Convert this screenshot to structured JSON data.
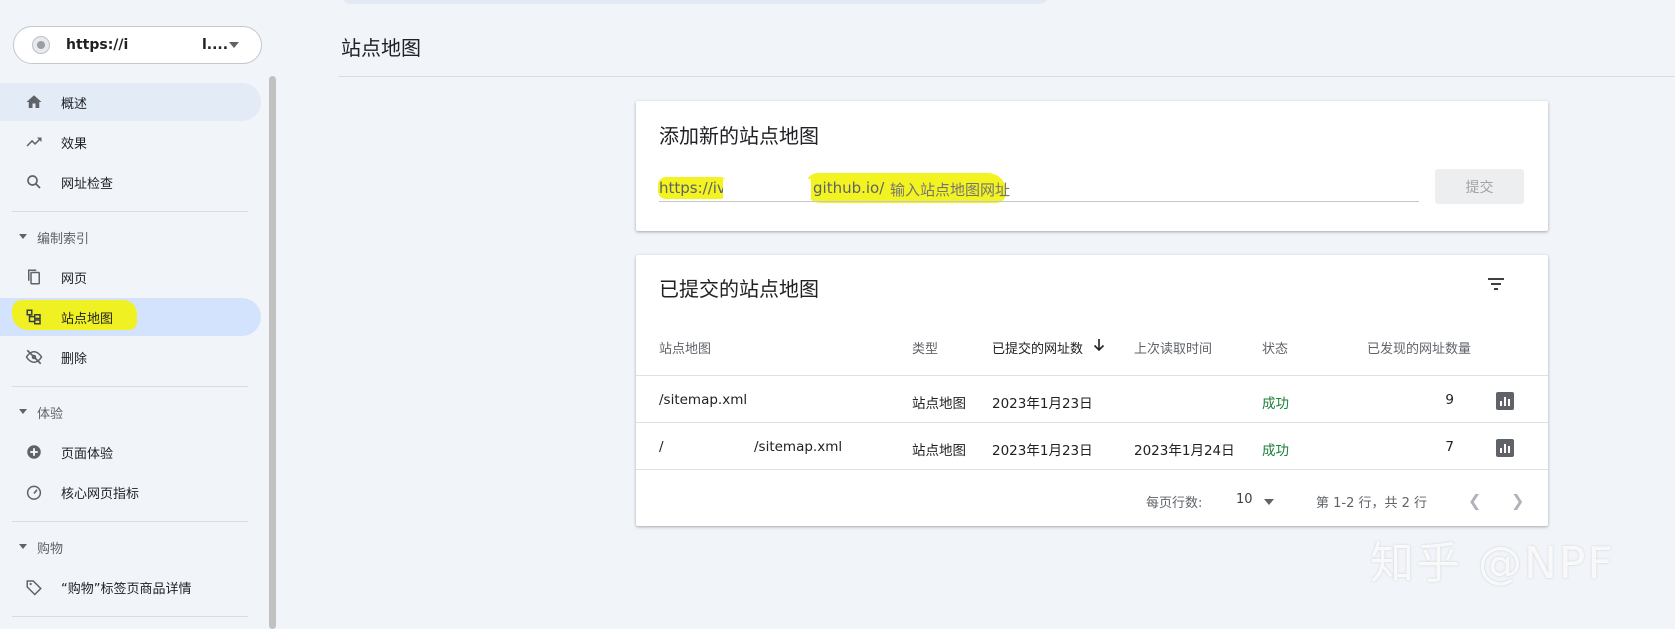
{
  "property": {
    "url_prefix": "https://i",
    "url_suffix": "l...."
  },
  "sidebar": {
    "top_items": [
      {
        "label": "概述",
        "icon": "home-icon"
      },
      {
        "label": "效果",
        "icon": "trending-up-icon"
      },
      {
        "label": "网址检查",
        "icon": "search-icon"
      }
    ],
    "sections": [
      {
        "title": "编制索引",
        "items": [
          {
            "label": "网页",
            "icon": "pages-icon"
          },
          {
            "label": "站点地图",
            "icon": "sitemap-icon"
          },
          {
            "label": "删除",
            "icon": "visibility-off-icon"
          }
        ]
      },
      {
        "title": "体验",
        "items": [
          {
            "label": "页面体验",
            "icon": "add-circle-icon"
          },
          {
            "label": "核心网页指标",
            "icon": "speedometer-icon"
          }
        ]
      },
      {
        "title": "购物",
        "items": [
          {
            "label": "“购物”标签页商品详情",
            "icon": "tag-icon"
          }
        ]
      }
    ]
  },
  "page_title": "站点地图",
  "add_card": {
    "title": "添加新的站点地图",
    "prefix_a": "https://ivan",
    "prefix_b": "github.io/",
    "placeholder": "输入站点地图网址",
    "submit_label": "提交"
  },
  "submitted_card": {
    "title": "已提交的站点地图",
    "columns": [
      "站点地图",
      "类型",
      "已提交的网址数",
      "上次读取时间",
      "状态",
      "已发现的网址数量"
    ],
    "sort_icon": "arrow-down-icon",
    "rows": [
      {
        "sitemap": "/sitemap.xml",
        "type": "站点地图",
        "submitted": "2023年1月23日",
        "last_read": "",
        "status": "成功",
        "discovered": "9"
      },
      {
        "sitemap": "/sitemap.xml",
        "type": "站点地图",
        "submitted": "2023年1月23日",
        "last_read": "2023年1月24日",
        "status": "成功",
        "discovered": "7"
      }
    ],
    "pagination": {
      "rows_label": "每页行数:",
      "rows_value": "10",
      "range": "第 1-2 行，共 2 行"
    }
  },
  "watermark": "知乎 @NPF",
  "colors": {
    "highlight": "#f2f20a",
    "success": "#188038",
    "active_nav": "#d3e3fd"
  }
}
